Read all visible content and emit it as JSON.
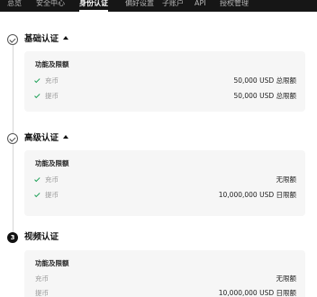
{
  "nav": {
    "tabs": [
      {
        "label": "总览",
        "active": false
      },
      {
        "label": "安全中心",
        "active": false
      },
      {
        "label": "身份认证",
        "active": true
      },
      {
        "label": "偏好设置",
        "active": false
      },
      {
        "label": "子账户",
        "active": false
      },
      {
        "label": "API",
        "active": false
      },
      {
        "label": "授权管理",
        "active": false
      }
    ]
  },
  "steps": [
    {
      "title": "基础认证",
      "status": "completed",
      "expanded": true,
      "section_title": "功能及限额",
      "rows": [
        {
          "label": "充币",
          "value": "50,000 USD 总限额",
          "checked": true
        },
        {
          "label": "提币",
          "value": "50,000 USD 总限额",
          "checked": true
        }
      ]
    },
    {
      "title": "高级认证",
      "status": "completed",
      "expanded": true,
      "section_title": "功能及限额",
      "rows": [
        {
          "label": "充币",
          "value": "无限额",
          "checked": true
        },
        {
          "label": "提币",
          "value": "10,000,000 USD 日限额",
          "checked": true
        }
      ]
    },
    {
      "title": "视频认证",
      "status": "pending",
      "step_number": "3",
      "section_title": "功能及限额",
      "rows": [
        {
          "label": "充币",
          "value": "无限额",
          "checked": false
        },
        {
          "label": "提币",
          "value": "10,000,000 USD 日限额",
          "checked": false
        }
      ]
    }
  ],
  "colors": {
    "nav_background": "#161616",
    "check_green": "#23a35c",
    "card_background": "#f6f6f6"
  }
}
